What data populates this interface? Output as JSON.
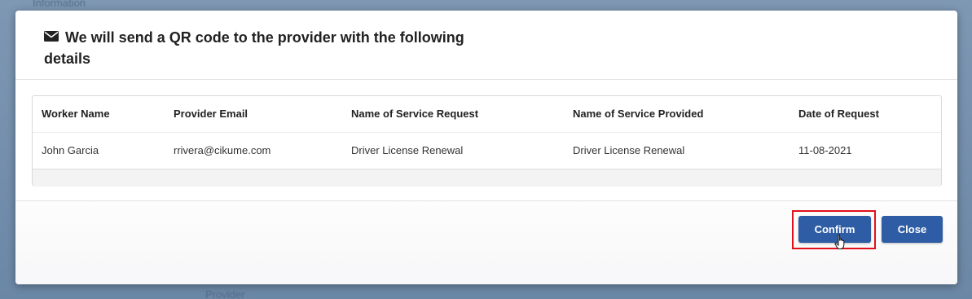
{
  "background": {
    "fragment_top": "Information",
    "fragment_bottom": "Provider"
  },
  "modal": {
    "title": "We will send a QR code to the provider with the following details",
    "title_icon": "envelope-icon",
    "table": {
      "columns": [
        "Worker Name",
        "Provider Email",
        "Name of Service Request",
        "Name of Service Provided",
        "Date of Request"
      ],
      "rows": [
        {
          "worker_name": "John Garcia",
          "provider_email": "rrivera@cikume.com",
          "service_request": "Driver License Renewal",
          "service_provided": "Driver License Renewal",
          "date_of_request": "11-08-2021"
        }
      ]
    },
    "buttons": {
      "confirm_label": "Confirm",
      "close_label": "Close"
    }
  },
  "colors": {
    "primary_button": "#2e5da5",
    "highlight": "#e0101a"
  }
}
